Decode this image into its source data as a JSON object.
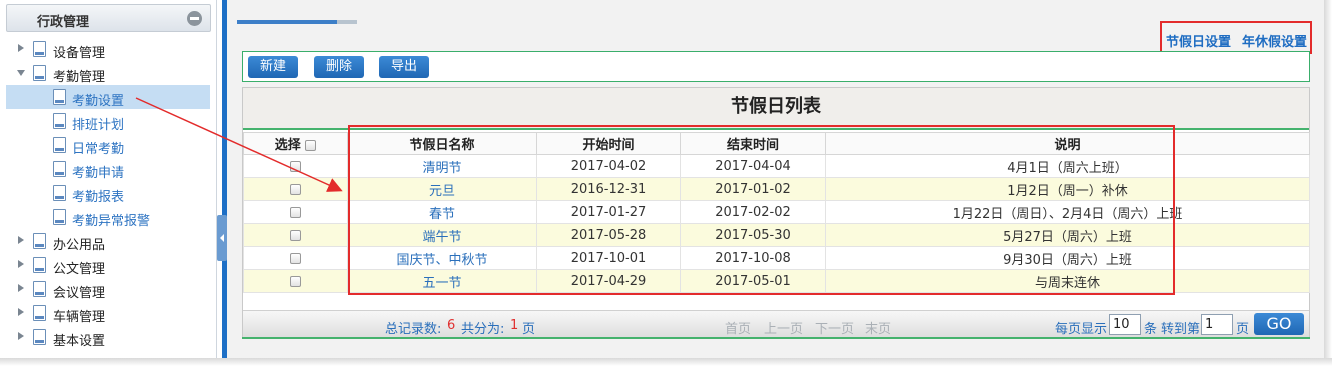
{
  "sidebar": {
    "title": "行政管理",
    "items": [
      {
        "label": "设备管理",
        "expanded": false,
        "level": 0
      },
      {
        "label": "考勤管理",
        "expanded": true,
        "level": 0
      },
      {
        "label": "考勤设置",
        "level": 1,
        "selected": true
      },
      {
        "label": "排班计划",
        "level": 1
      },
      {
        "label": "日常考勤",
        "level": 1
      },
      {
        "label": "考勤申请",
        "level": 1
      },
      {
        "label": "考勤报表",
        "level": 1
      },
      {
        "label": "考勤异常报警",
        "level": 1
      },
      {
        "label": "办公用品",
        "expanded": false,
        "level": 0
      },
      {
        "label": "公文管理",
        "expanded": false,
        "level": 0
      },
      {
        "label": "会议管理",
        "expanded": false,
        "level": 0
      },
      {
        "label": "车辆管理",
        "expanded": false,
        "level": 0
      },
      {
        "label": "基本设置",
        "expanded": false,
        "level": 0
      }
    ]
  },
  "top_links": {
    "holiday_settings": "节假日设置",
    "annual_leave_settings": "年休假设置"
  },
  "toolbar": {
    "new_label": "新建",
    "delete_label": "删除",
    "export_label": "导出"
  },
  "grid": {
    "title": "节假日列表",
    "columns": {
      "select": "选择",
      "name": "节假日名称",
      "start": "开始时间",
      "end": "结束时间",
      "note": "说明"
    },
    "rows": [
      {
        "name": "清明节",
        "start": "2017-04-02",
        "end": "2017-04-04",
        "note": "4月1日（周六上班）"
      },
      {
        "name": "元旦",
        "start": "2016-12-31",
        "end": "2017-01-02",
        "note": "1月2日（周一）补休"
      },
      {
        "name": "春节",
        "start": "2017-01-27",
        "end": "2017-02-02",
        "note": "1月22日（周日）、2月4日（周六）上班"
      },
      {
        "name": "端午节",
        "start": "2017-05-28",
        "end": "2017-05-30",
        "note": "5月27日（周六）上班"
      },
      {
        "name": "国庆节、中秋节",
        "start": "2017-10-01",
        "end": "2017-10-08",
        "note": "9月30日（周六）上班"
      },
      {
        "name": "五一节",
        "start": "2017-04-29",
        "end": "2017-05-01",
        "note": "与周末连休"
      }
    ]
  },
  "pager": {
    "total_label": "总记录数:",
    "total_value": "6",
    "pages_label": "共分为:",
    "pages_value": "1",
    "pages_unit": "页",
    "first": "首页",
    "prev": "上一页",
    "next": "下一页",
    "last": "末页",
    "per_page_label": "每页显示",
    "per_page_value": "10",
    "per_page_unit": "条",
    "goto_label": "转到第",
    "goto_value": "1",
    "goto_unit": "页",
    "go_label": "GO"
  },
  "colors": {
    "accent_blue": "#1f6dc2",
    "highlight_red": "#e32b2b",
    "row_alt": "#fbfbdd",
    "border_green": "#45b26d"
  }
}
